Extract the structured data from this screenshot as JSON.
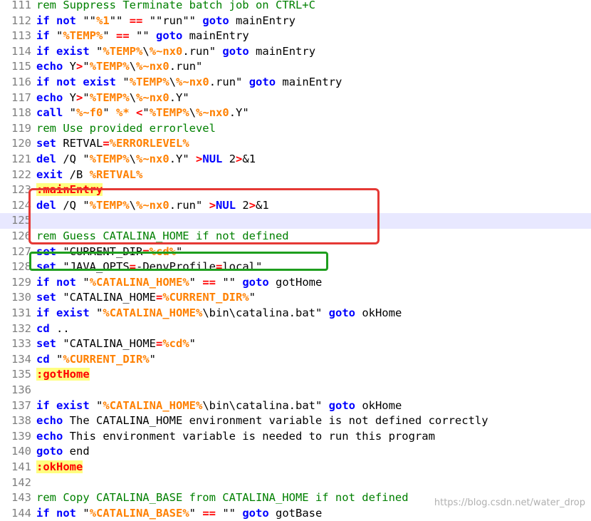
{
  "editor": {
    "lines": [
      {
        "num": "111",
        "tokens": [
          {
            "t": "cm",
            "v": "rem Suppress Terminate batch job on CTRL+C"
          }
        ]
      },
      {
        "num": "112",
        "tokens": [
          {
            "t": "kw",
            "v": "if"
          },
          {
            "t": "",
            "v": " "
          },
          {
            "t": "kw",
            "v": "not"
          },
          {
            "t": "",
            "v": " \"\""
          },
          {
            "t": "var",
            "v": "%1"
          },
          {
            "t": "",
            "v": "\"\" "
          },
          {
            "t": "op",
            "v": "=="
          },
          {
            "t": "",
            "v": " \"\"run\"\" "
          },
          {
            "t": "kw",
            "v": "goto"
          },
          {
            "t": "",
            "v": " mainEntry"
          }
        ]
      },
      {
        "num": "113",
        "tokens": [
          {
            "t": "kw",
            "v": "if"
          },
          {
            "t": "",
            "v": " \""
          },
          {
            "t": "var",
            "v": "%TEMP%"
          },
          {
            "t": "",
            "v": "\" "
          },
          {
            "t": "op",
            "v": "=="
          },
          {
            "t": "",
            "v": " \"\" "
          },
          {
            "t": "kw",
            "v": "goto"
          },
          {
            "t": "",
            "v": " mainEntry"
          }
        ]
      },
      {
        "num": "114",
        "tokens": [
          {
            "t": "kw",
            "v": "if"
          },
          {
            "t": "",
            "v": " "
          },
          {
            "t": "kw",
            "v": "exist"
          },
          {
            "t": "",
            "v": " \""
          },
          {
            "t": "var",
            "v": "%TEMP%"
          },
          {
            "t": "",
            "v": "\\"
          },
          {
            "t": "var",
            "v": "%~nx0"
          },
          {
            "t": "",
            "v": ".run\" "
          },
          {
            "t": "kw",
            "v": "goto"
          },
          {
            "t": "",
            "v": " mainEntry"
          }
        ]
      },
      {
        "num": "115",
        "tokens": [
          {
            "t": "kw",
            "v": "echo"
          },
          {
            "t": "",
            "v": " Y"
          },
          {
            "t": "op",
            "v": ">"
          },
          {
            "t": "",
            "v": "\""
          },
          {
            "t": "var",
            "v": "%TEMP%"
          },
          {
            "t": "",
            "v": "\\"
          },
          {
            "t": "var",
            "v": "%~nx0"
          },
          {
            "t": "",
            "v": ".run\""
          }
        ]
      },
      {
        "num": "116",
        "tokens": [
          {
            "t": "kw",
            "v": "if"
          },
          {
            "t": "",
            "v": " "
          },
          {
            "t": "kw",
            "v": "not"
          },
          {
            "t": "",
            "v": " "
          },
          {
            "t": "kw",
            "v": "exist"
          },
          {
            "t": "",
            "v": " \""
          },
          {
            "t": "var",
            "v": "%TEMP%"
          },
          {
            "t": "",
            "v": "\\"
          },
          {
            "t": "var",
            "v": "%~nx0"
          },
          {
            "t": "",
            "v": ".run\" "
          },
          {
            "t": "kw",
            "v": "goto"
          },
          {
            "t": "",
            "v": " mainEntry"
          }
        ]
      },
      {
        "num": "117",
        "tokens": [
          {
            "t": "kw",
            "v": "echo"
          },
          {
            "t": "",
            "v": " Y"
          },
          {
            "t": "op",
            "v": ">"
          },
          {
            "t": "",
            "v": "\""
          },
          {
            "t": "var",
            "v": "%TEMP%"
          },
          {
            "t": "",
            "v": "\\"
          },
          {
            "t": "var",
            "v": "%~nx0"
          },
          {
            "t": "",
            "v": ".Y\""
          }
        ]
      },
      {
        "num": "118",
        "tokens": [
          {
            "t": "kw",
            "v": "call"
          },
          {
            "t": "",
            "v": " \""
          },
          {
            "t": "var",
            "v": "%~f0"
          },
          {
            "t": "",
            "v": "\" "
          },
          {
            "t": "var",
            "v": "%*"
          },
          {
            "t": "",
            "v": " "
          },
          {
            "t": "op",
            "v": "<"
          },
          {
            "t": "",
            "v": "\""
          },
          {
            "t": "var",
            "v": "%TEMP%"
          },
          {
            "t": "",
            "v": "\\"
          },
          {
            "t": "var",
            "v": "%~nx0"
          },
          {
            "t": "",
            "v": ".Y\""
          }
        ]
      },
      {
        "num": "119",
        "tokens": [
          {
            "t": "cm",
            "v": "rem Use provided errorlevel"
          }
        ]
      },
      {
        "num": "120",
        "tokens": [
          {
            "t": "kw",
            "v": "set"
          },
          {
            "t": "",
            "v": " RETVAL"
          },
          {
            "t": "op",
            "v": "="
          },
          {
            "t": "var",
            "v": "%ERRORLEVEL%"
          }
        ]
      },
      {
        "num": "121",
        "tokens": [
          {
            "t": "kw",
            "v": "del"
          },
          {
            "t": "",
            "v": " /Q \""
          },
          {
            "t": "var",
            "v": "%TEMP%"
          },
          {
            "t": "",
            "v": "\\"
          },
          {
            "t": "var",
            "v": "%~nx0"
          },
          {
            "t": "",
            "v": ".Y\" "
          },
          {
            "t": "op",
            "v": ">"
          },
          {
            "t": "kw",
            "v": "NUL"
          },
          {
            "t": "",
            "v": " 2"
          },
          {
            "t": "op",
            "v": ">"
          },
          {
            "t": "",
            "v": "&1"
          }
        ]
      },
      {
        "num": "122",
        "tokens": [
          {
            "t": "kw",
            "v": "exit"
          },
          {
            "t": "",
            "v": " /B "
          },
          {
            "t": "var",
            "v": "%RETVAL%"
          }
        ]
      },
      {
        "num": "123",
        "tokens": [
          {
            "t": "lbl",
            "v": ":mainEntry"
          }
        ]
      },
      {
        "num": "124",
        "tokens": [
          {
            "t": "kw",
            "v": "del"
          },
          {
            "t": "",
            "v": " /Q \""
          },
          {
            "t": "var",
            "v": "%TEMP%"
          },
          {
            "t": "",
            "v": "\\"
          },
          {
            "t": "var",
            "v": "%~nx0"
          },
          {
            "t": "",
            "v": ".run\" "
          },
          {
            "t": "op",
            "v": ">"
          },
          {
            "t": "kw",
            "v": "NUL"
          },
          {
            "t": "",
            "v": " 2"
          },
          {
            "t": "op",
            "v": ">"
          },
          {
            "t": "",
            "v": "&1"
          }
        ]
      },
      {
        "num": "125",
        "current": true,
        "tokens": []
      },
      {
        "num": "126",
        "tokens": [
          {
            "t": "cm",
            "v": "rem Guess CATALINA_HOME if not defined"
          }
        ]
      },
      {
        "num": "127",
        "tokens": [
          {
            "t": "kw",
            "v": "set"
          },
          {
            "t": "",
            "v": " \"CURRENT_DIR"
          },
          {
            "t": "op",
            "v": "="
          },
          {
            "t": "var",
            "v": "%cd%"
          },
          {
            "t": "",
            "v": "\""
          }
        ]
      },
      {
        "num": "128",
        "tokens": [
          {
            "t": "kw",
            "v": "set"
          },
          {
            "t": "",
            "v": " \"JAVA_OPTS"
          },
          {
            "t": "op",
            "v": "="
          },
          {
            "t": "",
            "v": "-DenvProfile"
          },
          {
            "t": "op",
            "v": "="
          },
          {
            "t": "",
            "v": "local\""
          }
        ]
      },
      {
        "num": "129",
        "tokens": [
          {
            "t": "kw",
            "v": "if"
          },
          {
            "t": "",
            "v": " "
          },
          {
            "t": "kw",
            "v": "not"
          },
          {
            "t": "",
            "v": " \""
          },
          {
            "t": "var",
            "v": "%CATALINA_HOME%"
          },
          {
            "t": "",
            "v": "\" "
          },
          {
            "t": "op",
            "v": "=="
          },
          {
            "t": "",
            "v": " \"\" "
          },
          {
            "t": "kw",
            "v": "goto"
          },
          {
            "t": "",
            "v": " gotHome"
          }
        ]
      },
      {
        "num": "130",
        "tokens": [
          {
            "t": "kw",
            "v": "set"
          },
          {
            "t": "",
            "v": " \"CATALINA_HOME"
          },
          {
            "t": "op",
            "v": "="
          },
          {
            "t": "var",
            "v": "%CURRENT_DIR%"
          },
          {
            "t": "",
            "v": "\""
          }
        ]
      },
      {
        "num": "131",
        "tokens": [
          {
            "t": "kw",
            "v": "if"
          },
          {
            "t": "",
            "v": " "
          },
          {
            "t": "kw",
            "v": "exist"
          },
          {
            "t": "",
            "v": " \""
          },
          {
            "t": "var",
            "v": "%CATALINA_HOME%"
          },
          {
            "t": "",
            "v": "\\bin\\catalina.bat\" "
          },
          {
            "t": "kw",
            "v": "goto"
          },
          {
            "t": "",
            "v": " okHome"
          }
        ]
      },
      {
        "num": "132",
        "tokens": [
          {
            "t": "kw",
            "v": "cd"
          },
          {
            "t": "",
            "v": " .."
          }
        ]
      },
      {
        "num": "133",
        "tokens": [
          {
            "t": "kw",
            "v": "set"
          },
          {
            "t": "",
            "v": " \"CATALINA_HOME"
          },
          {
            "t": "op",
            "v": "="
          },
          {
            "t": "var",
            "v": "%cd%"
          },
          {
            "t": "",
            "v": "\""
          }
        ]
      },
      {
        "num": "134",
        "tokens": [
          {
            "t": "kw",
            "v": "cd"
          },
          {
            "t": "",
            "v": " \""
          },
          {
            "t": "var",
            "v": "%CURRENT_DIR%"
          },
          {
            "t": "",
            "v": "\""
          }
        ]
      },
      {
        "num": "135",
        "tokens": [
          {
            "t": "lbl",
            "v": ":gotHome"
          }
        ]
      },
      {
        "num": "136",
        "tokens": []
      },
      {
        "num": "137",
        "tokens": [
          {
            "t": "kw",
            "v": "if"
          },
          {
            "t": "",
            "v": " "
          },
          {
            "t": "kw",
            "v": "exist"
          },
          {
            "t": "",
            "v": " \""
          },
          {
            "t": "var",
            "v": "%CATALINA_HOME%"
          },
          {
            "t": "",
            "v": "\\bin\\catalina.bat\" "
          },
          {
            "t": "kw",
            "v": "goto"
          },
          {
            "t": "",
            "v": " okHome"
          }
        ]
      },
      {
        "num": "138",
        "tokens": [
          {
            "t": "kw",
            "v": "echo"
          },
          {
            "t": "",
            "v": " The CATALINA_HOME environment variable is not defined correctly"
          }
        ]
      },
      {
        "num": "139",
        "tokens": [
          {
            "t": "kw",
            "v": "echo"
          },
          {
            "t": "",
            "v": " This environment variable is needed to run this program"
          }
        ]
      },
      {
        "num": "140",
        "tokens": [
          {
            "t": "kw",
            "v": "goto"
          },
          {
            "t": "",
            "v": " end"
          }
        ]
      },
      {
        "num": "141",
        "tokens": [
          {
            "t": "lbl",
            "v": ":okHome"
          }
        ]
      },
      {
        "num": "142",
        "tokens": []
      },
      {
        "num": "143",
        "tokens": [
          {
            "t": "cm",
            "v": "rem Copy CATALINA_BASE from CATALINA_HOME if not defined"
          }
        ]
      },
      {
        "num": "144",
        "tokens": [
          {
            "t": "kw",
            "v": "if"
          },
          {
            "t": "",
            "v": " "
          },
          {
            "t": "kw",
            "v": "not"
          },
          {
            "t": "",
            "v": " \""
          },
          {
            "t": "var",
            "v": "%CATALINA_BASE%"
          },
          {
            "t": "",
            "v": "\" "
          },
          {
            "t": "op",
            "v": "=="
          },
          {
            "t": "",
            "v": " \"\" "
          },
          {
            "t": "kw",
            "v": "goto"
          },
          {
            "t": "",
            "v": " gotBase"
          }
        ]
      }
    ]
  },
  "watermark": "https://blog.csdn.net/water_drop",
  "colors": {
    "keyword": "#0000ff",
    "variable": "#ff8000",
    "operator": "#ff0000",
    "comment": "#008000",
    "label_bg": "#ffff80",
    "current_line": "#e8e8ff",
    "annotation_red": "#e53935",
    "annotation_green": "#1e9e1e"
  }
}
